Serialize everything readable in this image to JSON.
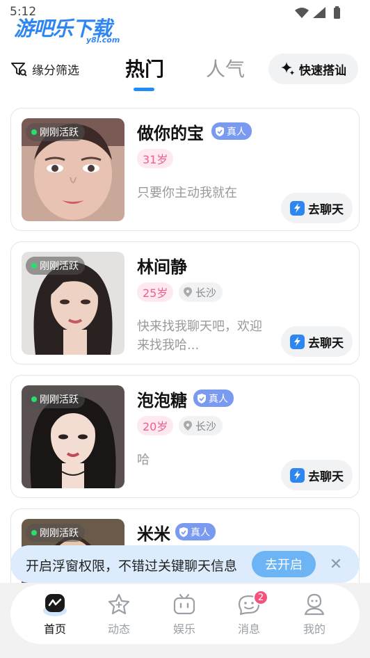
{
  "status_bar": {
    "time": "5:12"
  },
  "watermark": {
    "main": "游吧乐下载",
    "sub": "y8l.com"
  },
  "top_nav": {
    "filter_label": "缘分筛选",
    "tabs": [
      {
        "label": "热门",
        "active": true
      },
      {
        "label": "人气",
        "active": false
      }
    ],
    "quick_button": "快速搭讪"
  },
  "users": [
    {
      "name": "做你的宝",
      "verified": "真人",
      "active": "刚刚活跃",
      "age": "31岁",
      "city": "",
      "bio": "只要你主动我就在",
      "chat_label": "去聊天"
    },
    {
      "name": "林间静",
      "verified": "",
      "active": "刚刚活跃",
      "age": "25岁",
      "city": "长沙",
      "bio": "快来找我聊天吧，欢迎来找我哈...",
      "chat_label": "去聊天"
    },
    {
      "name": "泡泡糖",
      "verified": "真人",
      "active": "刚刚活跃",
      "age": "20岁",
      "city": "长沙",
      "bio": "哈",
      "chat_label": "去聊天"
    },
    {
      "name": "米米",
      "verified": "真人",
      "active": "刚刚活跃",
      "age": "",
      "city": "",
      "bio": "",
      "chat_label": ""
    }
  ],
  "banner": {
    "text": "开启浮窗权限，不错过关键聊天信息",
    "button": "去开启"
  },
  "bottom_nav": [
    {
      "label": "首页",
      "icon": "home-icon",
      "active": true
    },
    {
      "label": "动态",
      "icon": "star-icon",
      "active": false
    },
    {
      "label": "娱乐",
      "icon": "tv-icon",
      "active": false
    },
    {
      "label": "消息",
      "icon": "chat-face-icon",
      "active": false,
      "badge": "2"
    },
    {
      "label": "我的",
      "icon": "user-icon",
      "active": false
    }
  ],
  "colors": {
    "accent": "#1e8df5",
    "age_pink": "#f0608c",
    "verified_blue": "#7a9af0",
    "badge_red": "#f5527d"
  }
}
